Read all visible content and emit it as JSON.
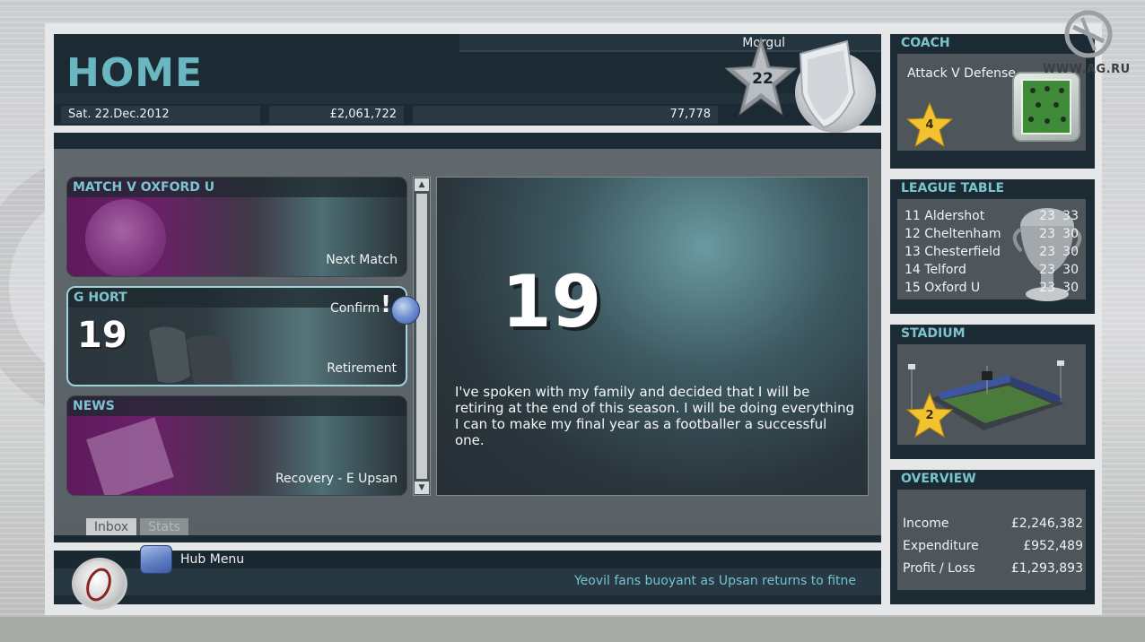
{
  "header": {
    "title": "HOME",
    "manager_name": "Morgul",
    "date": "Sat. 22.Dec.2012",
    "balance": "£2,061,722",
    "fans": "77,778",
    "reputation": "22"
  },
  "inbox": {
    "items": [
      {
        "title": "MATCH V OXFORD U",
        "subtitle": "Next Match"
      },
      {
        "title": "G HORT",
        "number": "19",
        "flag": "!",
        "subtitle": "Retirement"
      },
      {
        "title": "NEWS",
        "subtitle": "Recovery - E Upsan"
      }
    ],
    "scroll_up": "▲",
    "scroll_down": "▼"
  },
  "detail": {
    "number": "19",
    "message": "I've spoken with my family and decided that I will be retiring at the end of this season. I will be doing everything I can to make my final year as a footballer a successful one.",
    "confirm_label": "Confirm"
  },
  "tabs": {
    "inbox": "Inbox",
    "stats": "Stats"
  },
  "footer": {
    "hub_menu": "Hub Menu",
    "ticker": "Yeovil fans buoyant as Upsan returns to fitne"
  },
  "coach": {
    "title": "COACH",
    "label": "Attack V Defense",
    "stars": "4"
  },
  "league_table": {
    "title": "LEAGUE TABLE",
    "rows": [
      {
        "team": "11 Aldershot",
        "played": "23",
        "points": "33"
      },
      {
        "team": "12 Cheltenham",
        "played": "23",
        "points": "30"
      },
      {
        "team": "13 Chesterfield",
        "played": "23",
        "points": "30"
      },
      {
        "team": "14 Telford",
        "played": "23",
        "points": "30"
      },
      {
        "team": "15 Oxford U",
        "played": "23",
        "points": "30"
      }
    ]
  },
  "stadium": {
    "title": "STADIUM",
    "stars": "2"
  },
  "overview": {
    "title": "OVERVIEW",
    "rows": [
      {
        "label": "Income",
        "value": "£2,246,382"
      },
      {
        "label": "Expenditure",
        "value": "£952,489"
      },
      {
        "label": "Profit / Loss",
        "value": "£1,293,893"
      }
    ]
  },
  "watermark": "WWW.AG.RU",
  "colors": {
    "accent_teal": "#7cc4cf",
    "panel_dark": "#1c2a33",
    "card_purple": "#6a1f68",
    "gold_star": "#f2c230"
  }
}
